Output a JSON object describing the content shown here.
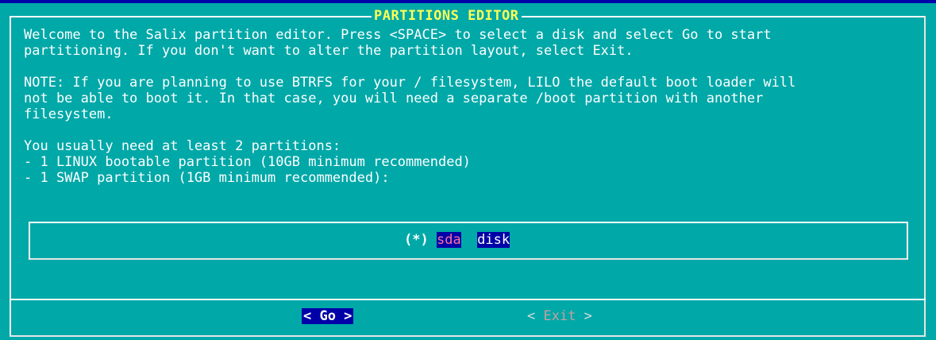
{
  "dialog": {
    "title": "PARTITIONS EDITOR",
    "message": "Welcome to the Salix partition editor. Press <SPACE> to select a disk and select Go to start\npartitioning. If you don't want to alter the partition layout, select Exit.\n\nNOTE: If you are planning to use BTRFS for your / filesystem, LILO the default boot loader will\nnot be able to boot it. In that case, you will need a separate /boot partition with another\nfilesystem.\n\nYou usually need at least 2 partitions:\n- 1 LINUX bootable partition (10GB minimum recommended)\n- 1 SWAP partition (1GB minimum recommended):"
  },
  "menu": {
    "items": [
      {
        "marker": "(*)",
        "tag": "sda",
        "description": "disk"
      }
    ]
  },
  "buttons": {
    "go_label": "< Go >",
    "exit_left": "< ",
    "exit_label": "Exit",
    "exit_right": " >"
  },
  "colors": {
    "background": "#00a8a8",
    "title": "#ffff54",
    "selected": "#0000a8"
  }
}
